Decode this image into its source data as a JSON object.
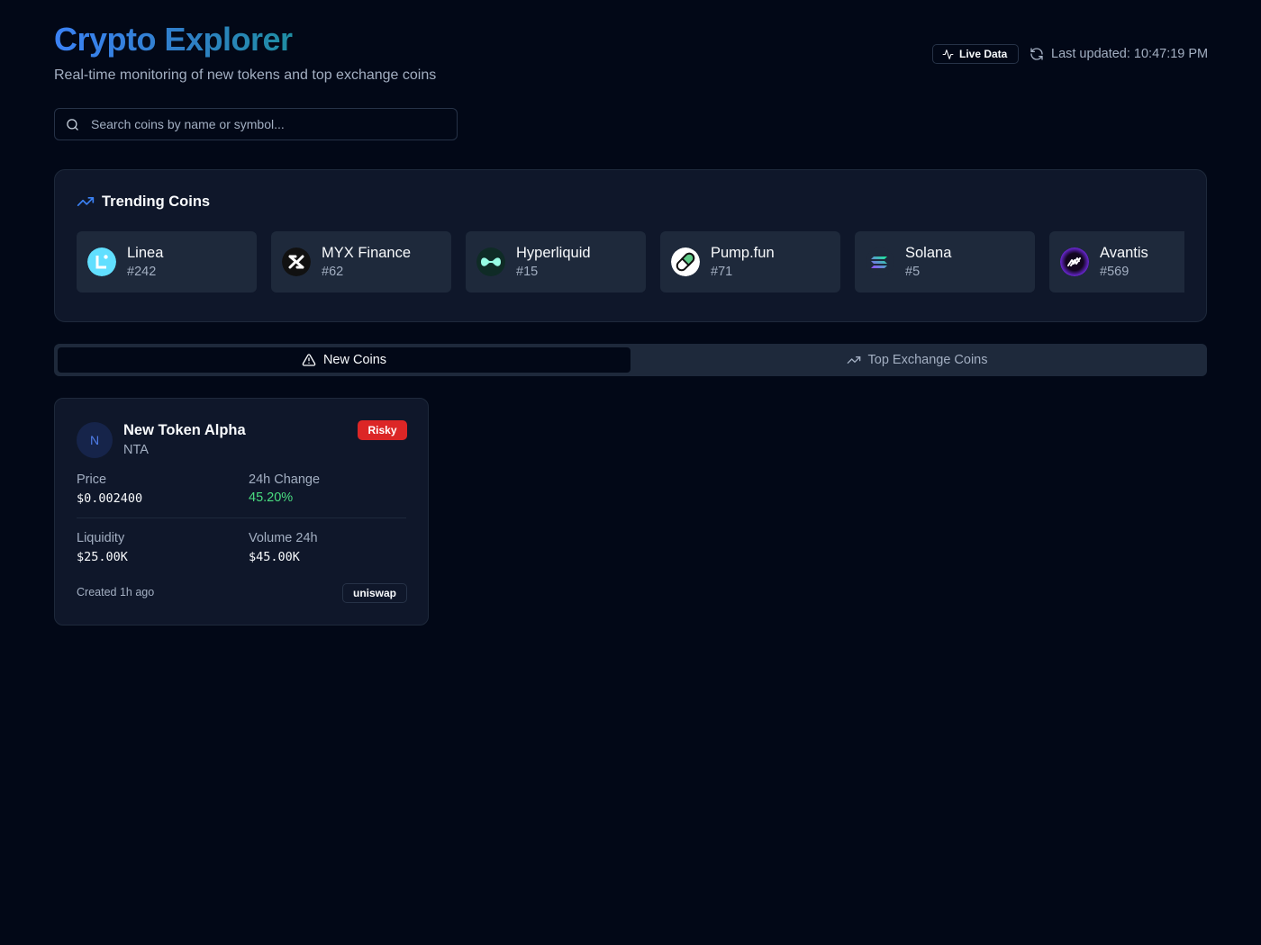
{
  "header": {
    "title": "Crypto Explorer",
    "subtitle": "Real-time monitoring of new tokens and top exchange coins",
    "live_badge": "Live Data",
    "last_updated": "Last updated: 10:47:19 PM"
  },
  "search": {
    "placeholder": "Search coins by name or symbol...",
    "value": ""
  },
  "trending": {
    "title": "Trending Coins",
    "items": [
      {
        "name": "Linea",
        "rank": "#242",
        "icon": "linea-logo"
      },
      {
        "name": "MYX Finance",
        "rank": "#62",
        "icon": "myx-logo"
      },
      {
        "name": "Hyperliquid",
        "rank": "#15",
        "icon": "hyperliquid-logo"
      },
      {
        "name": "Pump.fun",
        "rank": "#71",
        "icon": "pump-pill-logo"
      },
      {
        "name": "Solana",
        "rank": "#5",
        "icon": "solana-logo"
      },
      {
        "name": "Avantis",
        "rank": "#569",
        "icon": "avantis-logo"
      }
    ]
  },
  "tabs": [
    {
      "label": "New Coins",
      "icon": "warning-triangle-icon",
      "active": true
    },
    {
      "label": "Top Exchange Coins",
      "icon": "trending-up-icon",
      "active": false
    }
  ],
  "coin_card": {
    "avatar_letter": "N",
    "name": "New Token Alpha",
    "symbol": "NTA",
    "risk_label": "Risky",
    "price_label": "Price",
    "price_value": "$0.002400",
    "change_label": "24h Change",
    "change_value": "45.20%",
    "liquidity_label": "Liquidity",
    "liquidity_value": "$25.00K",
    "volume_label": "Volume 24h",
    "volume_value": "$45.00K",
    "created": "Created 1h ago",
    "exchange": "uniswap"
  },
  "colors": {
    "background": "#020817",
    "card": "#0f172a",
    "accent_blue": "#3b82f6",
    "positive": "#4ade80",
    "risky": "#dc2626"
  }
}
